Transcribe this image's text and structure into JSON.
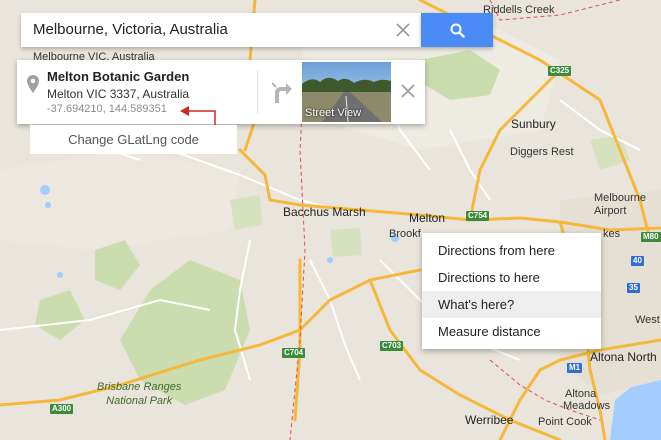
{
  "search": {
    "value": "Melbourne, Victoria, Australia",
    "clear_icon": "close-icon",
    "button_icon": "search-icon",
    "button_color": "#4a8af4"
  },
  "place_card": {
    "title": "Melton Botanic Garden",
    "address": "Melton VIC 3337, Australia",
    "coordinates": "-37.694210, 144.589351",
    "street_view_label": "Street View",
    "directions_icon": "directions-icon",
    "pin_icon": "pin-icon",
    "close_icon": "close-icon"
  },
  "annotation": {
    "text": "Change GLatLng code",
    "arrow_color": "#cc2b22"
  },
  "context_menu": {
    "items": [
      "Directions from here",
      "Directions to here",
      "What's here?",
      "Measure distance"
    ],
    "highlighted": "What's here?"
  },
  "map": {
    "places": {
      "riddells_creek": "Riddells Creek",
      "sunbury": "Sunbury",
      "diggers_rest": "Diggers Rest",
      "bacchus_marsh": "Bacchus Marsh",
      "melton": "Melton",
      "brookfield": "Brookf",
      "melbourne_airport": "Melbourne\nAirport",
      "altona_north": "Altona North",
      "altona": "Altona",
      "meadows": "Meadows",
      "point_cook": "Point Cook",
      "werribee": "Werribee",
      "west": "West",
      "melbourne_vic": "Melbourne VIC, Australia",
      "brisbane_ranges": "Brisbane Ranges\nNational Park",
      "kes": "kes"
    },
    "shields": {
      "c325": "C325",
      "c754": "C754",
      "c703": "C703",
      "c704": "C704",
      "a300": "A300",
      "m80": "M80",
      "m1": "M1",
      "r40": "40",
      "r35": "35"
    },
    "colors": {
      "land": "#e9e5dc",
      "park": "#cbdcaf",
      "water": "#a3ccff",
      "major_road": "#f6b83a",
      "minor_road": "#ffffff",
      "boundary": "#e05050"
    }
  }
}
